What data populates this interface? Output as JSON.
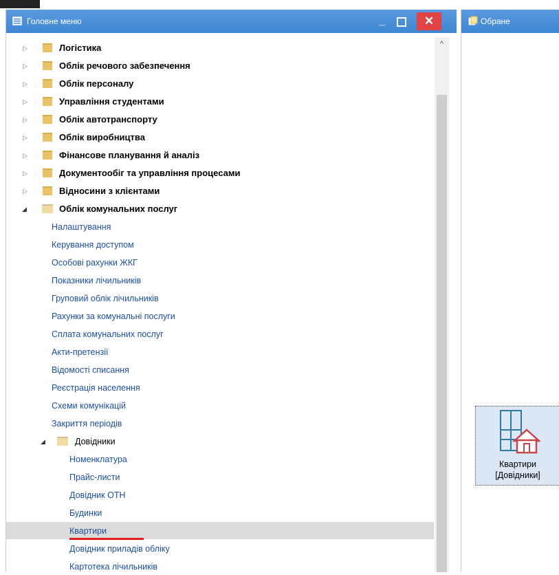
{
  "main_window": {
    "title": "Головне меню",
    "min_symbol": "_",
    "close_symbol": "✕"
  },
  "favorites_window": {
    "title": "Обране"
  },
  "tree": {
    "top_items": [
      {
        "label": "Логістика"
      },
      {
        "label": "Облік речового забезпечення"
      },
      {
        "label": "Облік персоналу"
      },
      {
        "label": "Управління студентами"
      },
      {
        "label": "Облік автотранспорту"
      },
      {
        "label": "Облік виробництва"
      },
      {
        "label": "Фінансове планування й аналіз"
      },
      {
        "label": "Документообіг та управління процесами"
      },
      {
        "label": "Відносини з клієнтами"
      }
    ],
    "expanded_item": {
      "label": "Облік комунальних послуг"
    },
    "sub_items": [
      {
        "label": "Налаштування"
      },
      {
        "label": "Керування доступом"
      },
      {
        "label": "Особові рахунки ЖКГ"
      },
      {
        "label": "Показники лічильників"
      },
      {
        "label": "Груповий облік лічильників"
      },
      {
        "label": "Рахунки за комунальні послуги"
      },
      {
        "label": "Сплата комунальних послуг"
      },
      {
        "label": "Акти-претензії"
      },
      {
        "label": "Відомості списання"
      },
      {
        "label": "Реєстрація населення"
      },
      {
        "label": "Схеми комунікацій"
      },
      {
        "label": "Закриття періодів"
      }
    ],
    "directories_folder": {
      "label": "Довідники"
    },
    "directories_items": [
      {
        "label": "Номенклатура"
      },
      {
        "label": "Прайс-листи"
      },
      {
        "label": "Довідник ОТН"
      },
      {
        "label": "Будинки"
      },
      {
        "label": "Квартири",
        "selected": true
      },
      {
        "label": "Довідник приладів обліку"
      },
      {
        "label": "Картотека лічильників"
      }
    ]
  },
  "favorite_tile": {
    "line1": "Квартири",
    "line2": "[Довідники]",
    "icon": "apartment-house-icon"
  },
  "colors": {
    "titlebar": "#4a8fd7",
    "close": "#e04343",
    "selection": "#dcdcdc",
    "underline": "#e01e1e",
    "tile_bg": "#dbe7f4"
  }
}
